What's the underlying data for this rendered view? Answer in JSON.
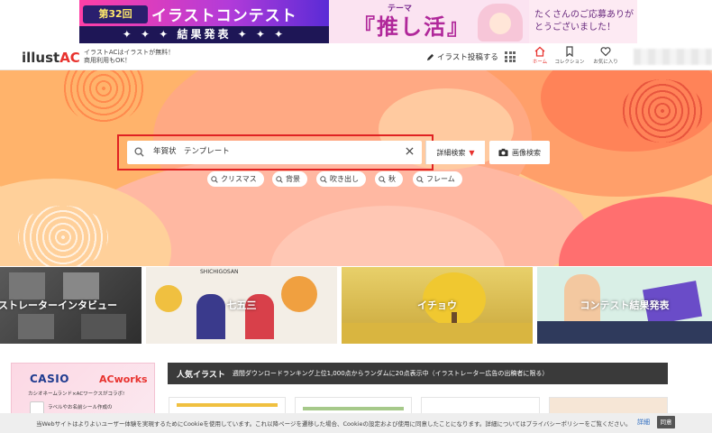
{
  "banner": {
    "round": "第32回",
    "contest": "イラストコンテスト",
    "result": "✦ ✦ ✦ 結果発表 ✦ ✦ ✦",
    "theme": "テーマ",
    "oshikatsu": "『推し活』",
    "thanks": "たくさんのご応募ありがとうございました！"
  },
  "header": {
    "logo_main": "illust",
    "logo_ac": "AC",
    "tagline_1": "イラストACはイラストが無料！",
    "tagline_2": "商用利用もOK！",
    "post_link": "イラスト投稿する",
    "nav": {
      "home": "ホーム",
      "collection": "コレクション",
      "favorites": "お気に入り"
    }
  },
  "search": {
    "query": "年賀状　テンプレート",
    "detail": "詳細検索",
    "image": "画像検索",
    "chips": [
      "クリスマス",
      "背景",
      "吹き出し",
      "秋",
      "フレーム"
    ]
  },
  "tiles": [
    {
      "label": "ストレーターインタビュー"
    },
    {
      "label": "七五三",
      "sub": "SHICHIGOSAN"
    },
    {
      "label": "イチョウ"
    },
    {
      "label": "コンテスト結果発表"
    }
  ],
  "ad": {
    "casio": "CASIO",
    "acworks": "ACworks",
    "sub": "カシオネームランド×ACワークスがコラボ!",
    "sub2": "ラベルやお名前シール作成の"
  },
  "popular": {
    "title": "人気イラスト",
    "desc": "週間ダウンロードランキング上位1,000点からランダムに20点表示中（イラストレーター広告の出稿者に限る）"
  },
  "cookie": {
    "text": "当Webサイトはよりよいユーザー体験を実現するためにCookieを使用しています。これ以降ページを遷移した場合、Cookieの設定および使用に同意したことになります。詳細についてはプライバシーポリシーをご覧ください。",
    "detail": "詳細",
    "agree": "同意"
  },
  "colors": {
    "accent": "#e8322e",
    "hero_bg": "#ffc88a",
    "highlight_box": "#e02222"
  }
}
